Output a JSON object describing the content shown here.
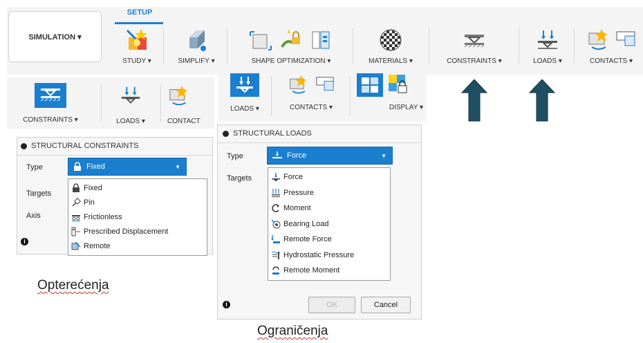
{
  "toolbar": {
    "simulation_label": "SIMULATION ▾",
    "setup_tab": "SETUP",
    "items": [
      {
        "label": "STUDY ▾"
      },
      {
        "label": "SIMPLIFY ▾"
      },
      {
        "label": "SHAPE OPTIMIZATION ▾"
      },
      {
        "label": "MATERIALS ▾"
      },
      {
        "label": "CONSTRAINTS ▾"
      },
      {
        "label": "LOADS ▾"
      },
      {
        "label": "CONTACTS ▾"
      }
    ]
  },
  "strip_left": {
    "constraints": "CONSTRAINTS ▾",
    "loads": "LOADS ▾",
    "contacts": "CONTACT"
  },
  "strip_right": {
    "loads": "LOADS ▾",
    "contacts": "CONTACTS ▾",
    "display": "DISPLAY ▾"
  },
  "constraints_panel": {
    "title": "STRUCTURAL CONSTRAINTS",
    "type_label": "Type",
    "targets_label": "Targets",
    "axis_label": "Axis",
    "selected": "Fixed",
    "options": [
      "Fixed",
      "Pin",
      "Frictionless",
      "Prescribed Displacement",
      "Remote"
    ]
  },
  "loads_panel": {
    "title": "STRUCTURAL LOADS",
    "type_label": "Type",
    "targets_label": "Targets",
    "selected": "Force",
    "options": [
      "Force",
      "Pressure",
      "Moment",
      "Bearing Load",
      "Remote Force",
      "Hydrostatic Pressure",
      "Remote Moment"
    ],
    "ok_label": "OK",
    "cancel_label": "Cancel"
  },
  "captions": {
    "left": "Opterećenja",
    "bottom": "Ograničenja"
  },
  "colors": {
    "accent": "#1b7fd0",
    "arrow": "#1f4e63"
  }
}
